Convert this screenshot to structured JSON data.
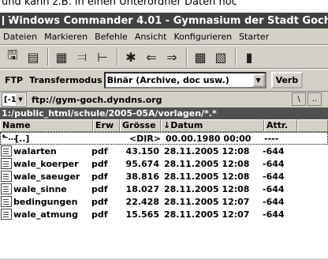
{
  "caption": "und kann z.B. in einen Unterordner Daten hoc",
  "window": {
    "title": "Windows Commander 4.01 - Gymnasium der Stadt Goch"
  },
  "menu": [
    "Dateien",
    "Markieren",
    "Befehle",
    "Ansicht",
    "Konfigurieren",
    "Starter"
  ],
  "toolbar_icons": [
    "floppy-save-icon",
    "view-list-icon",
    "grid-icon",
    "sort-icon",
    "tree-icon",
    "star-icon",
    "back-arrow-icon",
    "forward-arrow-icon",
    "compare-icon",
    "sync-icon",
    "notepad-icon"
  ],
  "ftp_bar": {
    "label": "FTP",
    "mode_label": "Transfermodus",
    "mode_value": "Binär (Archive, doc usw.)",
    "button": "Verb"
  },
  "drive": {
    "value": "[-1-]",
    "path": "ftp://gym-goch.dyndns.org",
    "btn_root": "\\",
    "btn_up": ".."
  },
  "current_path": "1:/public_html/schule/2005-05A/vorlagen/*.*",
  "columns": [
    "Name",
    "Erw",
    "Grösse",
    "↓Datum",
    "Attr."
  ],
  "files": [
    {
      "name": "[..]",
      "ext": "",
      "size": "<DIR>",
      "date": "00.00.1980 00:00",
      "attr": "----",
      "icon": "up-folder-icon"
    },
    {
      "name": "walarten",
      "ext": "pdf",
      "size": "43.150",
      "date": "28.11.2005 12:08",
      "attr": "-644",
      "icon": "pdf-file-icon"
    },
    {
      "name": "wale_koerper",
      "ext": "pdf",
      "size": "95.674",
      "date": "28.11.2005 12:08",
      "attr": "-644",
      "icon": "pdf-file-icon"
    },
    {
      "name": "wale_saeuger",
      "ext": "pdf",
      "size": "38.816",
      "date": "28.11.2005 12:08",
      "attr": "-644",
      "icon": "pdf-file-icon"
    },
    {
      "name": "wale_sinne",
      "ext": "pdf",
      "size": "18.027",
      "date": "28.11.2005 12:08",
      "attr": "-644",
      "icon": "pdf-file-icon"
    },
    {
      "name": "bedingungen",
      "ext": "pdf",
      "size": "22.428",
      "date": "28.11.2005 12:07",
      "attr": "-644",
      "icon": "pdf-file-icon"
    },
    {
      "name": "wale_atmung",
      "ext": "pdf",
      "size": "15.565",
      "date": "28.11.2005 12:07",
      "attr": "-644",
      "icon": "pdf-file-icon"
    }
  ]
}
